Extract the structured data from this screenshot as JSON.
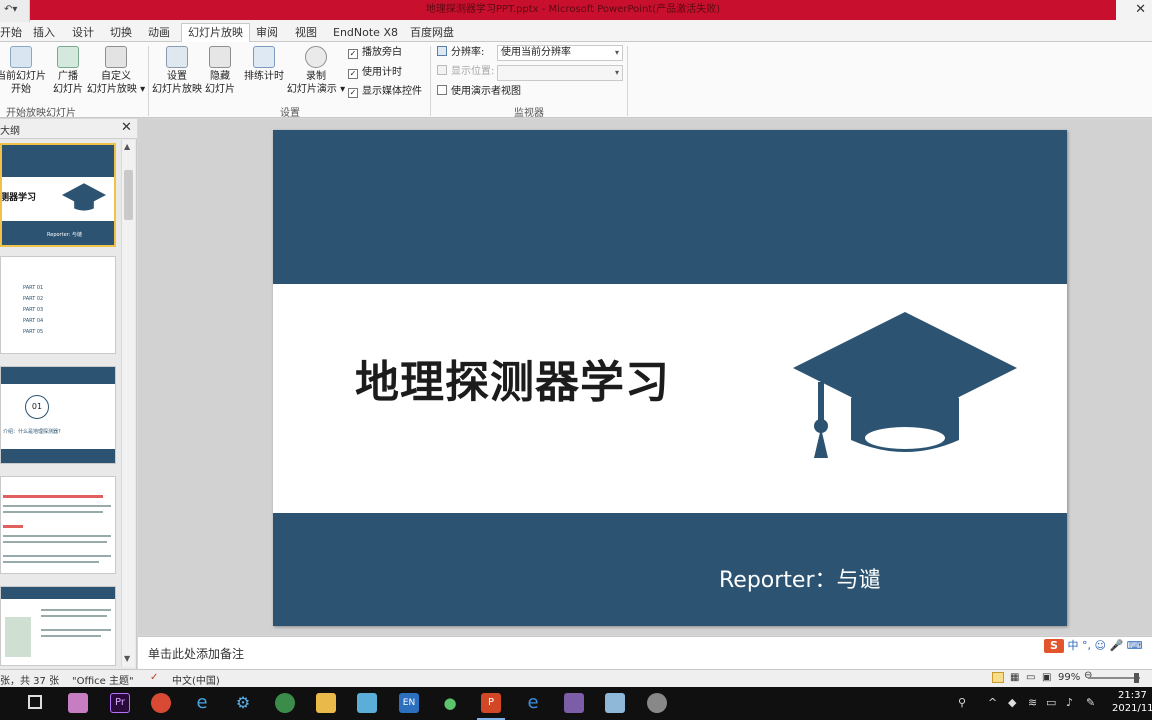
{
  "window": {
    "title": "地理探测器学习PPT.pptx - Microsoft PowerPoint(产品激活失败)"
  },
  "ribbon_tabs": [
    "开始",
    "插入",
    "设计",
    "切换",
    "动画",
    "幻灯片放映",
    "审阅",
    "视图",
    "EndNote X8",
    "百度网盘"
  ],
  "active_tab": "幻灯片放映",
  "ribbon": {
    "start_group": {
      "buttons": [
        {
          "line1": "当前幻灯片",
          "line2": "开始"
        },
        {
          "line1": "广播",
          "line2": "幻灯片"
        },
        {
          "line1": "自定义",
          "line2": "幻灯片放映 ▾"
        }
      ],
      "label": "开始放映幻灯片"
    },
    "setup_group": {
      "buttons": [
        {
          "line1": "设置",
          "line2": "幻灯片放映"
        },
        {
          "line1": "隐藏",
          "line2": "幻灯片"
        },
        {
          "line1": "排练计时",
          "line2": ""
        },
        {
          "line1": "录制",
          "line2": "幻灯片演示 ▾"
        }
      ],
      "checks": [
        {
          "label": "播放旁白",
          "checked": true
        },
        {
          "label": "使用计时",
          "checked": true
        },
        {
          "label": "显示媒体控件",
          "checked": true
        }
      ],
      "label": "设置"
    },
    "monitor_group": {
      "resolution_label": "分辨率:",
      "resolution_value": "使用当前分辨率",
      "show_on_label": "显示位置:",
      "show_on_value": "",
      "presenter_view": {
        "label": "使用演示者视图",
        "checked": false
      },
      "label": "监视器"
    }
  },
  "left_panel": {
    "tab_label": "大纲",
    "thumb1": {
      "title": "测器学习",
      "reporter": "Reporter: 与谴"
    },
    "thumb2": {
      "items": [
        "PART 01",
        "PART 02",
        "PART 03",
        "PART 04",
        "PART 05"
      ]
    },
    "thumb3": {
      "number": "01",
      "caption": "介绍：什么是地理探测器?"
    }
  },
  "slide": {
    "title": "地理探测器学习",
    "reporter": "Reporter：与谴",
    "colors": {
      "band_dark": "#2c5371",
      "band_light": "#ffffff",
      "title": "#1c1c1c"
    }
  },
  "notes": {
    "placeholder": "单击此处添加备注"
  },
  "ime": {
    "text": "中 °, ☺ 🎤 ⌨"
  },
  "statusbar": {
    "slide_count": "张，共 37 张",
    "theme": "\"Office 主题\"",
    "language": "中文(中国)",
    "zoom": "99%"
  },
  "taskbar": {
    "time": "21:37",
    "date": "2021/11"
  }
}
